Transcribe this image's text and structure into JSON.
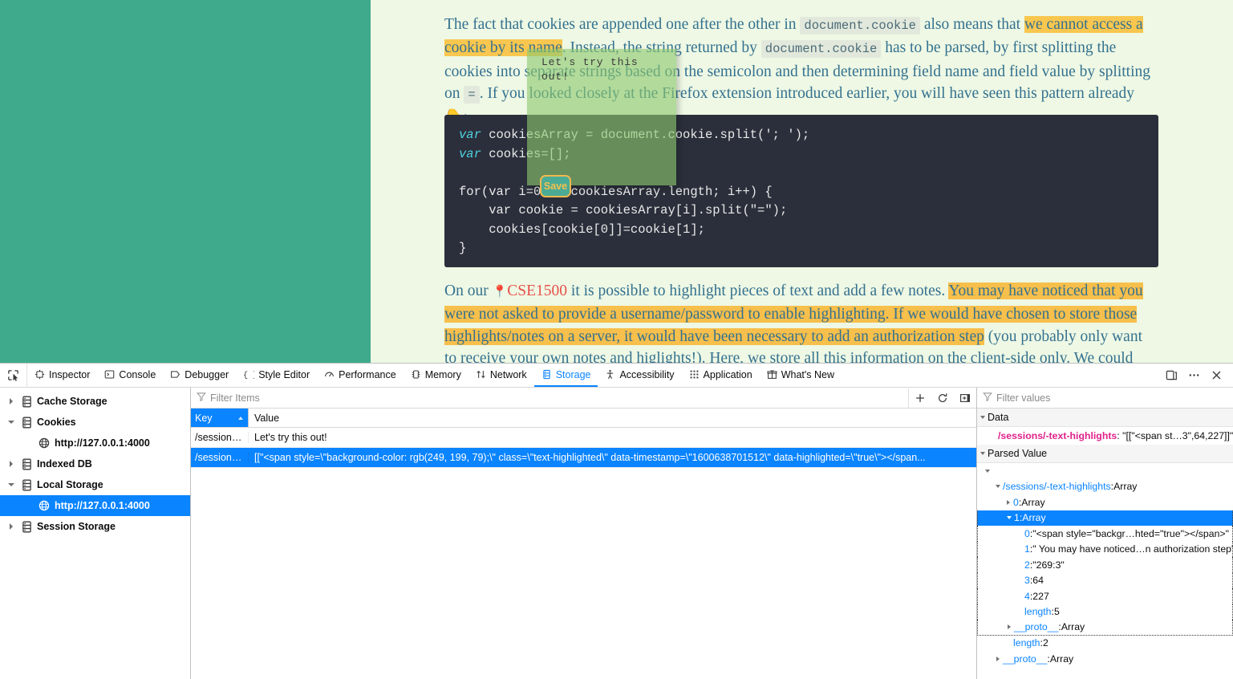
{
  "page": {
    "paragraph1": {
      "seg1": "The fact that cookies are appended one after the other in ",
      "code1": "document.cookie",
      "seg2": " also means that ",
      "hl1": "we cannot access a cookie by its name",
      "seg3": ". Instead, the string returned by ",
      "code2": "document.cookie",
      "seg4": " has to be parsed, by first splitting the cookies into separate strings based on the semicolon and then determining field name and field value by splitting on ",
      "code3": "=",
      "seg5": ". If you looked closely at the Firefox extension introduced earlier, you will have seen this pattern already ",
      "pointer_icon": "pointing-down-hand-icon",
      "seg6": ":"
    },
    "code_block": {
      "line1_kw": "var",
      "line1_rest": " cookiesArray = document.cookie.split('; ');",
      "line2_kw": "var",
      "line2_rest": " cookies=[];",
      "line3": "",
      "line4": "for(var i=0; i<cookiesArray.length; i++) {",
      "line5": "    var cookie = cookiesArray[i].split(\"=\");",
      "line6": "    cookies[cookie[0]]=cookie[1];",
      "line7": "}"
    },
    "paragraph2": {
      "seg1": "On our ",
      "pin_icon": "pin-icon",
      "link": "CSE1500",
      "seg2": " it is possible to highlight pieces of text and add a few notes. ",
      "hl1": "You may have noticed that you were not asked to provide a username/password to enable highlighting. If we would have chosen to store those highlights/notes on a server, it would have been necessary to add an authorization step",
      "seg3": " (you probably only want to receive your own notes and higlights!). Here, we store all this information on the client-side only. We could have"
    },
    "note_popup": {
      "text": "Let's try this out!",
      "save_label": "Save"
    }
  },
  "devtools": {
    "pick_icon": "element-picker-icon",
    "tabs": [
      {
        "label": "Inspector",
        "icon": "inspector-icon",
        "active": false
      },
      {
        "label": "Console",
        "icon": "console-icon",
        "active": false
      },
      {
        "label": "Debugger",
        "icon": "debugger-icon",
        "active": false
      },
      {
        "label": "Style Editor",
        "icon": "style-editor-icon",
        "active": false
      },
      {
        "label": "Performance",
        "icon": "performance-icon",
        "active": false
      },
      {
        "label": "Memory",
        "icon": "memory-icon",
        "active": false
      },
      {
        "label": "Network",
        "icon": "network-icon",
        "active": false
      },
      {
        "label": "Storage",
        "icon": "storage-icon",
        "active": true
      },
      {
        "label": "Accessibility",
        "icon": "accessibility-icon",
        "active": false
      },
      {
        "label": "Application",
        "icon": "application-icon",
        "active": false
      },
      {
        "label": "What's New",
        "icon": "gift-icon",
        "active": false
      }
    ],
    "right_buttons": [
      {
        "icon": "dock-to-side-icon"
      },
      {
        "icon": "meatball-menu-icon"
      },
      {
        "icon": "close-icon"
      }
    ],
    "tree": [
      {
        "label": "Cache Storage",
        "icon": "storage-box-icon",
        "level": 0,
        "open": false,
        "selected": false
      },
      {
        "label": "Cookies",
        "icon": "storage-box-icon",
        "level": 0,
        "open": true,
        "selected": false
      },
      {
        "label": "http://127.0.0.1:4000",
        "icon": "globe-icon",
        "level": 1,
        "open": null,
        "selected": false
      },
      {
        "label": "Indexed DB",
        "icon": "storage-box-icon",
        "level": 0,
        "open": false,
        "selected": false
      },
      {
        "label": "Local Storage",
        "icon": "storage-box-icon",
        "level": 0,
        "open": true,
        "selected": false
      },
      {
        "label": "http://127.0.0.1:4000",
        "icon": "globe-icon",
        "level": 1,
        "open": null,
        "selected": true
      },
      {
        "label": "Session Storage",
        "icon": "storage-box-icon",
        "level": 0,
        "open": false,
        "selected": false
      }
    ],
    "table": {
      "filter_placeholder": "Filter Items",
      "filter_value": "",
      "filter_icon": "funnel-icon",
      "actions": [
        {
          "icon": "plus-icon"
        },
        {
          "icon": "refresh-icon"
        },
        {
          "icon": "toggle-sidebar-icon"
        }
      ],
      "columns": [
        "Key",
        "Value"
      ],
      "sort_column": "Key",
      "sort_direction": "asc",
      "rows": [
        {
          "key": "/session…",
          "value": "Let's try this out!",
          "selected": false
        },
        {
          "key": "/session…",
          "value": "[[\"<span style=\\\"background-color: rgb(249, 199, 79);\\\" class=\\\"text-highlighted\\\" data-timestamp=\\\"1600638701512\\\" data-highlighted=\\\"true\\\"></span...",
          "selected": true
        }
      ]
    },
    "values": {
      "filter_placeholder": "Filter values",
      "filter_value": "",
      "filter_icon": "funnel-icon",
      "data_section": "Data",
      "data_key": "/sessions/-text-highlights",
      "data_value": "\"[[\"<span st…3\",64,227]]\"",
      "parsed_section": "Parsed Value",
      "nodes": [
        {
          "indent": 0,
          "twisty": "open",
          "key": "",
          "value": "",
          "selected": false
        },
        {
          "indent": 1,
          "twisty": "open",
          "key": "/sessions/-text-highlights",
          "value": "Array",
          "selected": false
        },
        {
          "indent": 2,
          "twisty": "closed",
          "key": "0",
          "value": "Array",
          "selected": false
        },
        {
          "indent": 2,
          "twisty": "open",
          "key": "1",
          "value": "Array",
          "selected": true
        },
        {
          "indent": 3,
          "twisty": "none",
          "key": "0",
          "value": "\"<span style=\"backgr…hted=\"true\"></span>\"",
          "selected": false
        },
        {
          "indent": 3,
          "twisty": "none",
          "key": "1",
          "value": "\" You may have noticed…n authorization step\"",
          "selected": false
        },
        {
          "indent": 3,
          "twisty": "none",
          "key": "2",
          "value": "\"269:3\"",
          "selected": false
        },
        {
          "indent": 3,
          "twisty": "none",
          "key": "3",
          "value": "64",
          "selected": false
        },
        {
          "indent": 3,
          "twisty": "none",
          "key": "4",
          "value": "227",
          "selected": false
        },
        {
          "indent": 3,
          "twisty": "none",
          "key": "length",
          "value": "5",
          "selected": false
        },
        {
          "indent": 2,
          "twisty": "closed",
          "key": "__proto__",
          "value": "Array",
          "selected": false
        },
        {
          "indent": 2,
          "twisty": "none",
          "key": "length",
          "value": "2",
          "selected": false
        },
        {
          "indent": 1,
          "twisty": "closed",
          "key": "__proto__",
          "value": "Array",
          "selected": false
        }
      ]
    }
  },
  "colors": {
    "accent_blue": "#0a84ff",
    "highlight_yellow": "#f9c74f",
    "teal_rail": "#3fab8c",
    "page_bg": "#eef8e4",
    "code_bg": "#2b2f3b",
    "note_green": "#8cc86e",
    "link_red": "#e8504a",
    "key_pink": "#e0218a"
  }
}
